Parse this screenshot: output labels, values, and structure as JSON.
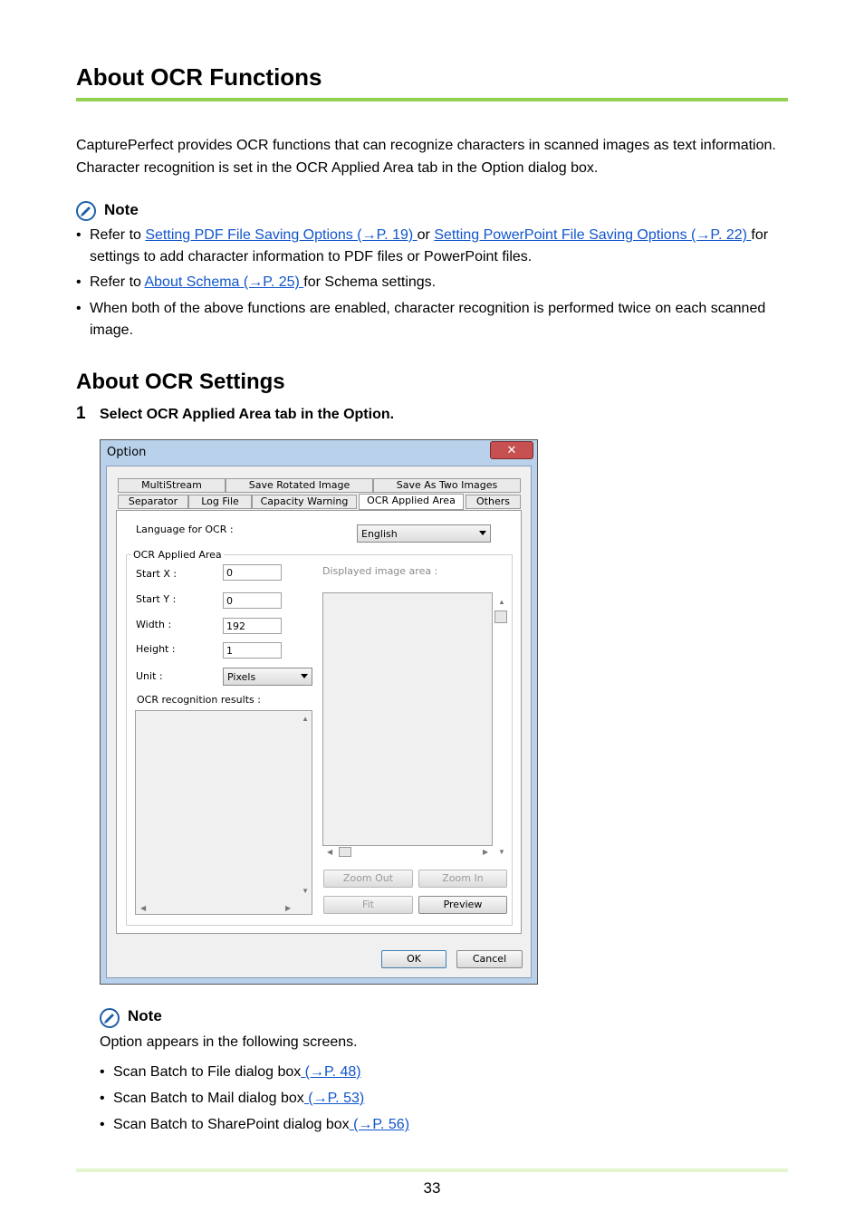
{
  "heading": "About OCR Functions",
  "intro": "CapturePerfect provides OCR functions that can recognize characters in scanned images as text information. Character recognition is set in the OCR Applied Area tab in the Option dialog box.",
  "note1": {
    "title": "Note",
    "b1_pre": "Refer to ",
    "b1_link1": "Setting PDF File Saving Options (→P. 19) ",
    "b1_mid": " or ",
    "b1_link2": "Setting PowerPoint File Saving Options (→P. 22) ",
    "b1_post": " for settings to add character information to PDF files or PowerPoint files.",
    "b2_pre": "Refer to ",
    "b2_link": "About Schema (→P. 25) ",
    "b2_post": " for Schema settings.",
    "b3": "When both of the above functions are enabled, character recognition is performed twice on each scanned image."
  },
  "subheading": "About OCR Settings",
  "step": {
    "number": "1",
    "text": "Select OCR Applied Area tab in the Option."
  },
  "dialog": {
    "title": "Option",
    "close": "✕",
    "tabs_row1": [
      "MultiStream",
      "Save Rotated Image",
      "Save As Two Images"
    ],
    "tabs_row2": [
      "Separator",
      "Log File",
      "Capacity Warning",
      "OCR Applied Area",
      "Others"
    ],
    "language_label": "Language for OCR :",
    "language_value": "English",
    "group_label": "OCR Applied Area",
    "startx_label": "Start X :",
    "startx_value": "0",
    "starty_label": "Start Y :",
    "starty_value": "0",
    "width_label": "Width :",
    "width_value": "192",
    "height_label": "Height :",
    "height_value": "1",
    "unit_label": "Unit :",
    "unit_value": "Pixels",
    "results_label": "OCR recognition results :",
    "displayed_label": "Displayed image area :",
    "zoom_out": "Zoom Out",
    "zoom_in": "Zoom In",
    "fit": "Fit",
    "preview": "Preview",
    "ok": "OK",
    "cancel": "Cancel"
  },
  "note2": {
    "title": "Note",
    "intro": "Option appears in the following screens.",
    "b1_text": "Scan Batch to File dialog box",
    "b1_link": " (→P. 48) ",
    "b2_text": "Scan Batch to Mail dialog box",
    "b2_link": " (→P. 53) ",
    "b3_text": "Scan Batch to SharePoint dialog box",
    "b3_link": " (→P. 56) "
  },
  "page_number": "33",
  "colors": {
    "rule": "#92d050",
    "link": "#1155cc",
    "footer_rule": "#e2f5cf"
  },
  "icons": [
    "note-icon"
  ]
}
